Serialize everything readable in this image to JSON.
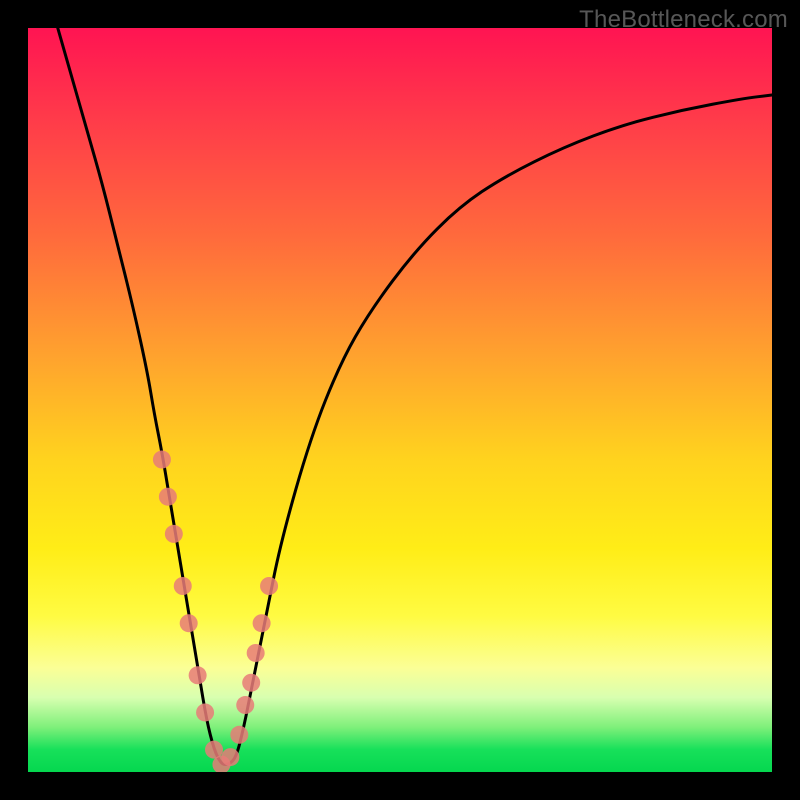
{
  "watermark": "TheBottleneck.com",
  "chart_data": {
    "type": "line",
    "title": "",
    "xlabel": "",
    "ylabel": "",
    "xlim": [
      0,
      100
    ],
    "ylim": [
      0,
      100
    ],
    "series": [
      {
        "name": "bottleneck-curve",
        "x": [
          4,
          6,
          8,
          10,
          12,
          14,
          16,
          17,
          18,
          19,
          20,
          21,
          22,
          23,
          24,
          25,
          26,
          27,
          28,
          29,
          30,
          32,
          34,
          38,
          42,
          46,
          52,
          58,
          64,
          72,
          80,
          88,
          96,
          100
        ],
        "y": [
          100,
          93,
          86,
          79,
          71,
          63,
          54,
          48,
          43,
          37,
          31,
          25,
          19,
          13,
          7,
          3,
          1,
          1,
          2,
          6,
          11,
          21,
          31,
          45,
          55,
          62,
          70,
          76,
          80,
          84,
          87,
          89,
          90.5,
          91
        ]
      }
    ],
    "markers": {
      "name": "data-points",
      "x": [
        18.0,
        18.8,
        19.6,
        20.8,
        21.6,
        22.8,
        23.8,
        25.0,
        26.0,
        27.2,
        28.4,
        29.2,
        30.0,
        30.6,
        31.4,
        32.4
      ],
      "y": [
        42,
        37,
        32,
        25,
        20,
        13,
        8,
        3,
        1,
        2,
        5,
        9,
        12,
        16,
        20,
        25
      ]
    },
    "gradient_stops": [
      {
        "pos": 0,
        "color": "#ff1452"
      },
      {
        "pos": 12,
        "color": "#ff3a4a"
      },
      {
        "pos": 28,
        "color": "#ff6a3c"
      },
      {
        "pos": 44,
        "color": "#ffa22e"
      },
      {
        "pos": 58,
        "color": "#ffd31e"
      },
      {
        "pos": 70,
        "color": "#ffed17"
      },
      {
        "pos": 79,
        "color": "#fffb42"
      },
      {
        "pos": 86,
        "color": "#fbff96"
      },
      {
        "pos": 90,
        "color": "#d8ffb0"
      },
      {
        "pos": 94,
        "color": "#7ef07a"
      },
      {
        "pos": 97,
        "color": "#17e05a"
      },
      {
        "pos": 100,
        "color": "#05d74f"
      }
    ]
  }
}
